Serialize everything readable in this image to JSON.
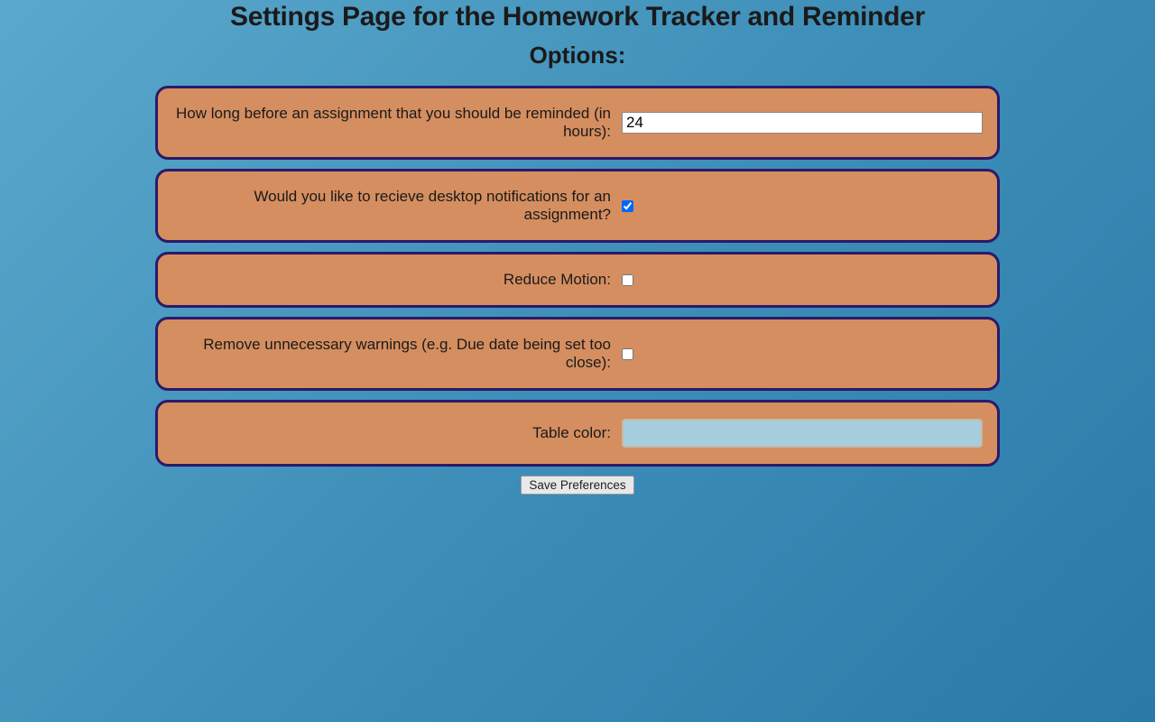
{
  "header": {
    "title": "Settings Page for the Homework Tracker and Reminder",
    "subtitle": "Options:"
  },
  "options": {
    "remind_hours": {
      "label": "How long before an assignment that you should be reminded (in hours):",
      "value": "24"
    },
    "desktop_notifications": {
      "label": "Would you like to recieve desktop notifications for an assignment?",
      "checked": true
    },
    "reduce_motion": {
      "label": "Reduce Motion:",
      "checked": false
    },
    "remove_warnings": {
      "label": "Remove unnecessary warnings (e.g. Due date being set too close):",
      "checked": false
    },
    "table_color": {
      "label": "Table color:",
      "value": "#a6cedd"
    }
  },
  "actions": {
    "save_label": "Save Preferences"
  }
}
